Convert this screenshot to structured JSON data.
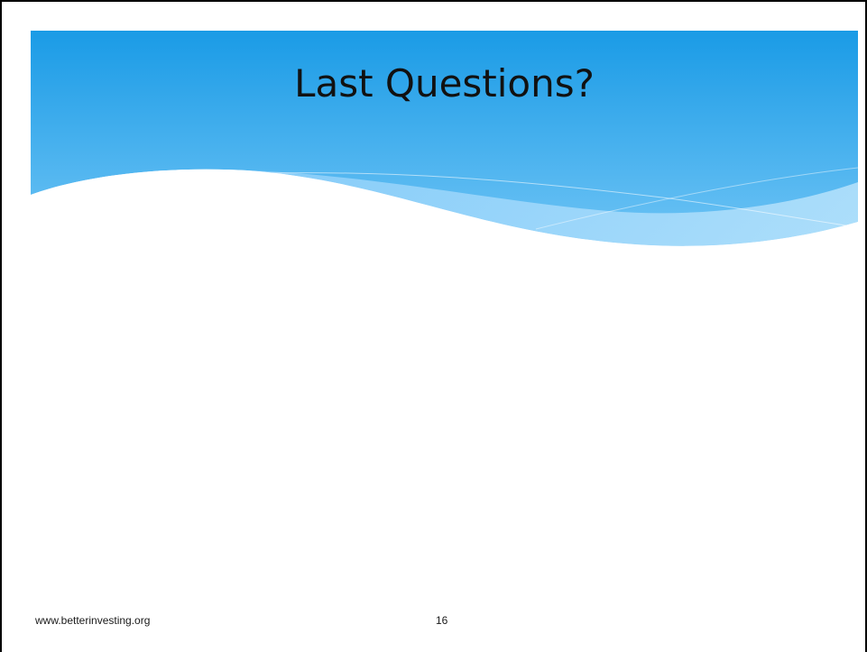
{
  "slide": {
    "title": "Last Questions?",
    "footer_url": "www.betterinvesting.org",
    "page_number": "16"
  },
  "colors": {
    "header_top": "#1a9be6",
    "header_bottom": "#6fc4f5",
    "wave_light": "#9fd7fb",
    "background": "#ffffff"
  }
}
